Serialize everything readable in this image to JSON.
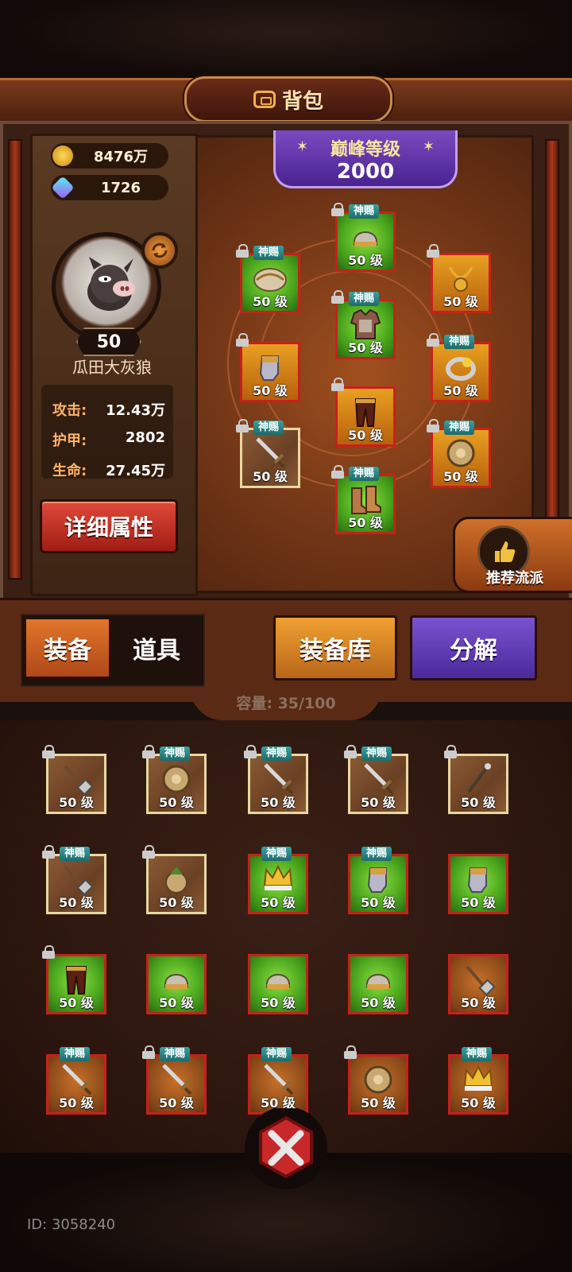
{
  "header": {
    "title": "背包"
  },
  "currency": {
    "gold": "8476万",
    "gems": "1726"
  },
  "hero": {
    "level": "50",
    "name": "瓜田大灰狼",
    "stats": [
      {
        "label": "攻击:",
        "value": "12.43万"
      },
      {
        "label": "护甲:",
        "value": "2802"
      },
      {
        "label": "生命:",
        "value": "27.45万"
      }
    ],
    "detail_button": "详细属性"
  },
  "peak": {
    "title": "巅峰等级",
    "value": "2000"
  },
  "equipped": [
    {
      "slot": "helmet",
      "tag": "神赐",
      "locked": true,
      "level": "50 级",
      "bg": "green",
      "icon": "helmet-icon"
    },
    {
      "slot": "shoulder",
      "tag": "神赐",
      "locked": true,
      "level": "50 级",
      "bg": "green",
      "icon": "shoulder-icon"
    },
    {
      "slot": "necklace",
      "tag": "",
      "locked": true,
      "level": "50 级",
      "bg": "orange",
      "icon": "necklace-icon"
    },
    {
      "slot": "armor",
      "tag": "神赐",
      "locked": true,
      "level": "50 级",
      "bg": "green",
      "icon": "armor-icon"
    },
    {
      "slot": "gloves",
      "tag": "",
      "locked": true,
      "level": "50 级",
      "bg": "orange",
      "icon": "gauntlet-icon"
    },
    {
      "slot": "ring",
      "tag": "神赐",
      "locked": true,
      "level": "50 级",
      "bg": "orange",
      "icon": "ring-icon"
    },
    {
      "slot": "pants",
      "tag": "",
      "locked": true,
      "level": "50 级",
      "bg": "orange",
      "icon": "pants-icon"
    },
    {
      "slot": "weapon",
      "tag": "神赐",
      "locked": true,
      "level": "50 级",
      "bg": "wood",
      "icon": "sword-icon"
    },
    {
      "slot": "shield",
      "tag": "神赐",
      "locked": true,
      "level": "50 级",
      "bg": "orange",
      "icon": "shield-icon"
    },
    {
      "slot": "boots",
      "tag": "神赐",
      "locked": true,
      "level": "50 级",
      "bg": "green",
      "icon": "boots-icon"
    }
  ],
  "recommend": {
    "label": "推荐流派"
  },
  "tabs": {
    "equip": "装备",
    "items": "道具"
  },
  "buttons": {
    "library": "装备库",
    "decompose": "分解"
  },
  "capacity": "容量: 35/100",
  "inventory": [
    {
      "tag": "",
      "locked": true,
      "level": "50 级",
      "bg": "wood",
      "icon": "hammer-icon"
    },
    {
      "tag": "神赐",
      "locked": true,
      "level": "50 级",
      "bg": "wood",
      "icon": "shield-icon"
    },
    {
      "tag": "神赐",
      "locked": true,
      "level": "50 级",
      "bg": "wood",
      "icon": "sword-icon"
    },
    {
      "tag": "神赐",
      "locked": true,
      "level": "50 级",
      "bg": "wood",
      "icon": "sword-icon"
    },
    {
      "tag": "",
      "locked": true,
      "level": "50 级",
      "bg": "wood",
      "icon": "staff-icon"
    },
    {
      "tag": "神赐",
      "locked": true,
      "level": "50 级",
      "bg": "wood",
      "icon": "hammer-icon"
    },
    {
      "tag": "",
      "locked": true,
      "level": "50 级",
      "bg": "wood",
      "icon": "acorn-icon"
    },
    {
      "tag": "神赐",
      "locked": false,
      "level": "50 级",
      "bg": "green",
      "icon": "crown-icon"
    },
    {
      "tag": "神赐",
      "locked": false,
      "level": "50 级",
      "bg": "green",
      "icon": "gauntlet-icon"
    },
    {
      "tag": "",
      "locked": false,
      "level": "50 级",
      "bg": "green",
      "icon": "gauntlet-icon"
    },
    {
      "tag": "",
      "locked": true,
      "level": "50 级",
      "bg": "green",
      "icon": "pants-icon"
    },
    {
      "tag": "",
      "locked": false,
      "level": "50 级",
      "bg": "green",
      "icon": "helmet-icon"
    },
    {
      "tag": "",
      "locked": false,
      "level": "50 级",
      "bg": "green",
      "icon": "helmet-icon"
    },
    {
      "tag": "",
      "locked": false,
      "level": "50 级",
      "bg": "green",
      "icon": "helmet-icon"
    },
    {
      "tag": "",
      "locked": false,
      "level": "50 级",
      "bg": "brown",
      "icon": "hammer-icon"
    },
    {
      "tag": "神赐",
      "locked": false,
      "level": "50 级",
      "bg": "brown",
      "icon": "sword-icon"
    },
    {
      "tag": "神赐",
      "locked": true,
      "level": "50 级",
      "bg": "brown",
      "icon": "sword-icon"
    },
    {
      "tag": "神赐",
      "locked": false,
      "level": "50 级",
      "bg": "brown",
      "icon": "sword-icon"
    },
    {
      "tag": "",
      "locked": true,
      "level": "50 级",
      "bg": "brown",
      "icon": "shield-icon"
    },
    {
      "tag": "神赐",
      "locked": false,
      "level": "50 级",
      "bg": "brown",
      "icon": "crown-icon"
    }
  ],
  "footer": {
    "id": "ID: 3058240"
  }
}
